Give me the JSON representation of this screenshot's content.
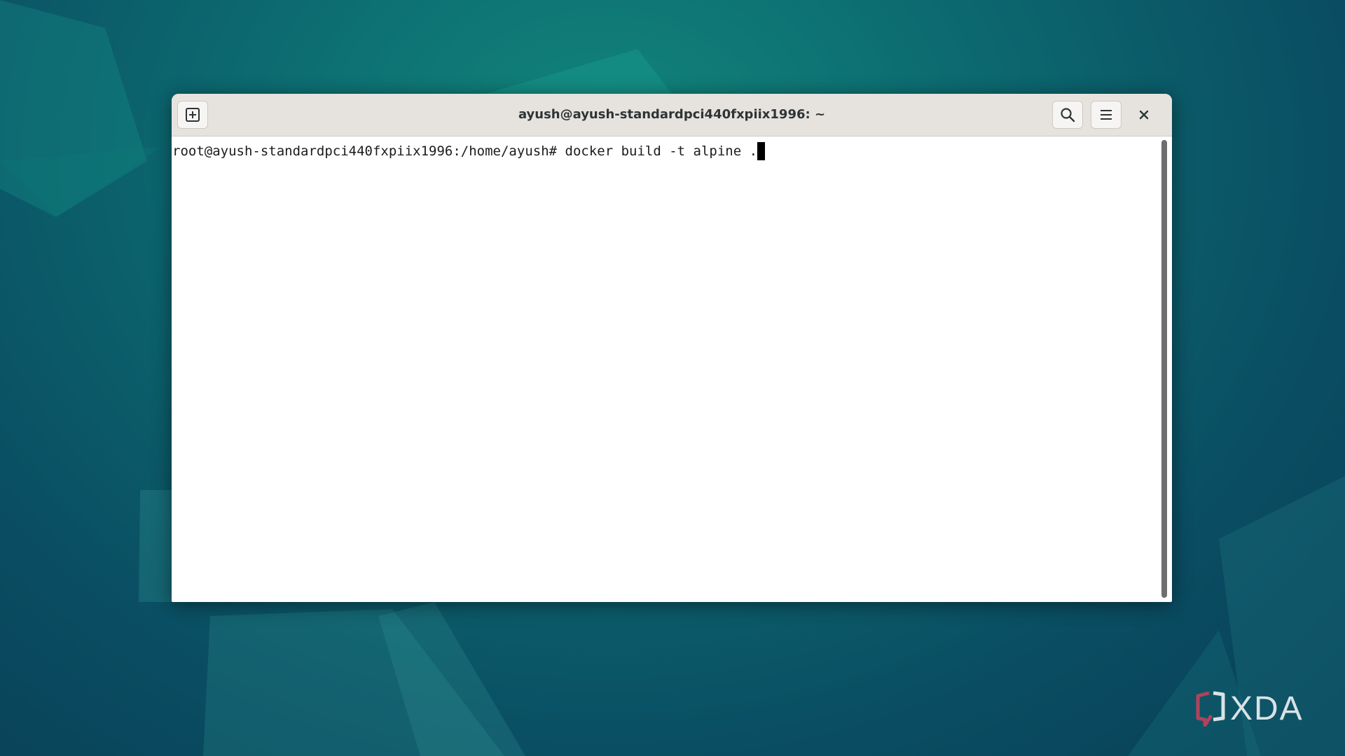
{
  "window": {
    "title": "ayush@ayush-standardpci440fxpiix1996: ~"
  },
  "headerbar": {
    "new_tab_icon": "new-tab-icon",
    "search_icon": "search-icon",
    "menu_icon": "hamburger-menu-icon",
    "close_icon": "close-icon"
  },
  "terminal": {
    "prompt": "root@ayush-standardpci440fxpiix1996:/home/ayush#",
    "command": " docker build -t alpine ."
  },
  "watermark": {
    "text": "XDA"
  },
  "colors": {
    "headerbar_bg": "#e6e3df",
    "terminal_bg": "#ffffff",
    "terminal_fg": "#1c1c1c",
    "desktop_teal": "#0c6a70",
    "desktop_dark": "#083f56"
  }
}
